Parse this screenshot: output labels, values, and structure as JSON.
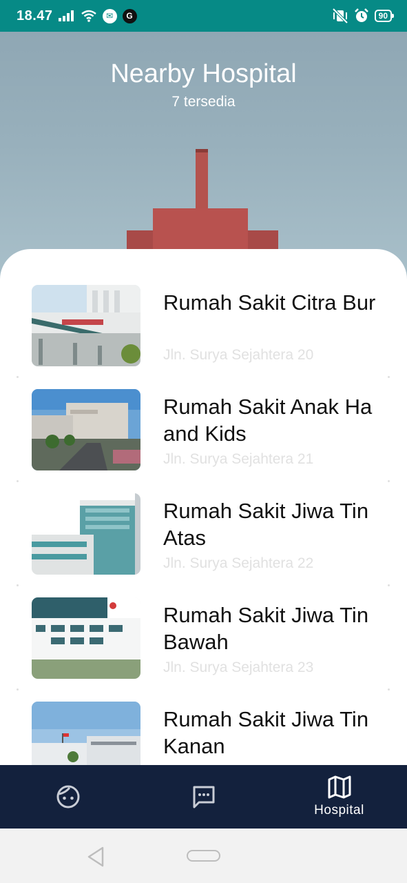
{
  "status_bar": {
    "time": "18.47",
    "app_icons": [
      "messenger-icon",
      "google-icon"
    ],
    "google_letter": "G",
    "battery": "90"
  },
  "header": {
    "title": "Nearby Hospital",
    "subtitle": "7 tersedia"
  },
  "hospitals": [
    {
      "name": "Rumah Sakit Citra Bur",
      "address": "Jln. Surya Sejahtera 20"
    },
    {
      "name": "Rumah Sakit Anak Ha and Kids",
      "address": "Jln. Surya Sejahtera 21"
    },
    {
      "name": "Rumah Sakit Jiwa Tin Atas",
      "address": "Jln. Surya Sejahtera 22"
    },
    {
      "name": "Rumah Sakit Jiwa Tin Bawah",
      "address": "Jln. Surya Sejahtera 23"
    },
    {
      "name": "Rumah Sakit Jiwa Tin Kanan",
      "address": ""
    }
  ],
  "bottom_nav": {
    "items": [
      {
        "icon": "face-icon",
        "label": ""
      },
      {
        "icon": "chat-icon",
        "label": ""
      },
      {
        "icon": "map-icon",
        "label": "Hospital"
      }
    ],
    "active_color": "#ffffff",
    "background": "#13213d"
  },
  "colors": {
    "status_bar": "#068a86",
    "address_text": "#e1e1e1"
  }
}
